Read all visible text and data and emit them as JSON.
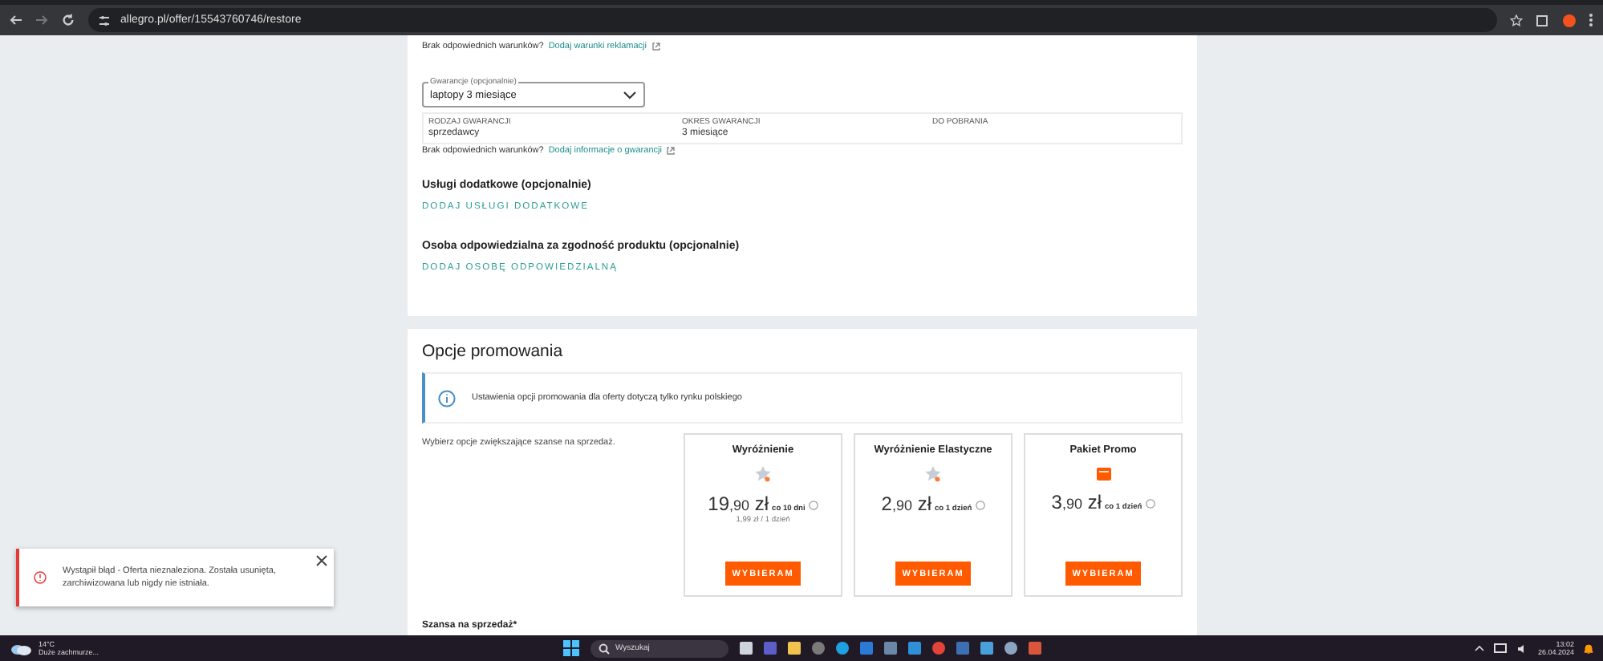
{
  "browser": {
    "url": "allegro.pl/offer/15543760746/restore"
  },
  "warranty_section": {
    "complaint_note": {
      "text": "Brak odpowiednich warunków?",
      "link": "Dodaj warunki reklamacji"
    },
    "select": {
      "label": "Gwarancje (opcjonalnie)",
      "value": "laptopy 3 miesiące"
    },
    "details": [
      {
        "heading": "RODZAJ GWARANCJI",
        "value": "sprzedawcy"
      },
      {
        "heading": "OKRES GWARANCJI",
        "value": "3 miesiące"
      },
      {
        "heading": "DO POBRANIA"
      }
    ],
    "warranty_note": {
      "text": "Brak odpowiednich warunków?",
      "link": "Dodaj informacje o gwarancji"
    },
    "extras": [
      {
        "title": "Usługi dodatkowe (opcjonalnie)",
        "action": "DODAJ USŁUGI DODATKOWE"
      },
      {
        "title": "Osoba odpowiedzialna za zgodność produktu (opcjonalnie)",
        "action": "DODAJ OSOBĘ ODPOWIEDZIALNĄ"
      }
    ]
  },
  "promotion": {
    "title": "Opcje promowania",
    "info": "Ustawienia opcji promowania dla oferty dotyczą tylko rynku polskiego",
    "intro": "Wybierz opcje zwiększające szanse na sprzedaż.",
    "options": [
      {
        "name": "Wyróżnienie",
        "kind": "star",
        "amount": "19",
        "fraction": ",90",
        "currency": "zł",
        "period": "co 10 dni",
        "per_day": "1,99 zł / 1 dzień",
        "button": "WYBIERAM"
      },
      {
        "name": "Wyróżnienie Elastyczne",
        "kind": "star",
        "amount": "2",
        "fraction": ",90",
        "currency": "zł",
        "period": "co 1 dzień",
        "button": "WYBIERAM"
      },
      {
        "name": "Pakiet Promo",
        "kind": "package",
        "amount": "3",
        "fraction": ",90",
        "currency": "zł",
        "period": "co 1 dzień",
        "button": "WYBIERAM"
      }
    ],
    "next_label": "Szansa na sprzedaż*"
  },
  "toast": {
    "message": "Wystąpił błąd - Oferta nieznaleziona. Została usunięta, zarchiwizowana lub nigdy nie istniała."
  },
  "taskbar": {
    "temperature": "14°C",
    "weather": "Duże zachmurze...",
    "search": "Wyszukaj",
    "time": "13:02",
    "date": "26.04.2024"
  }
}
